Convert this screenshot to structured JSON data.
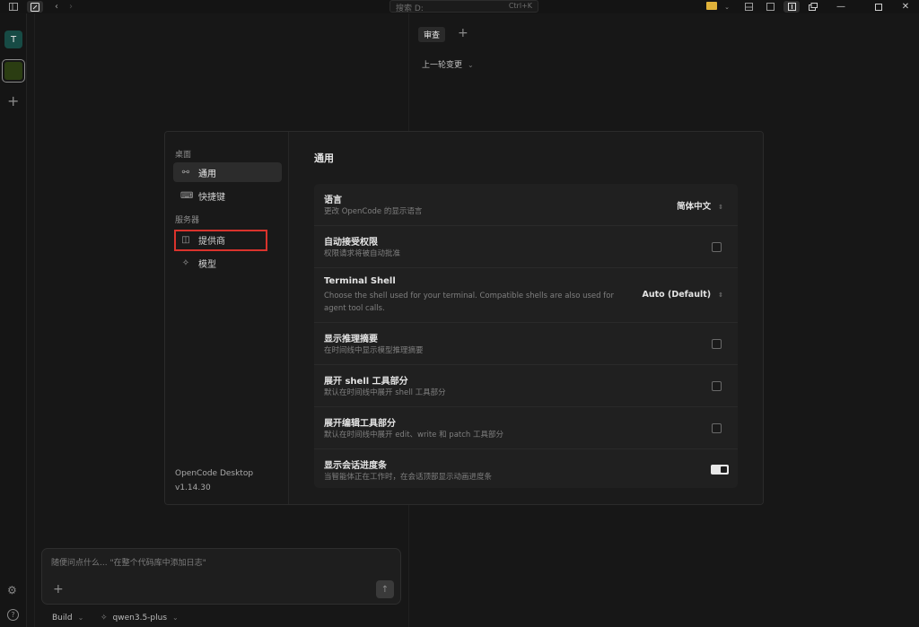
{
  "titlebar": {
    "search_placeholder": "搜索 D:",
    "search_shortcut": "Ctrl+K"
  },
  "rail": {
    "project_initial": "T"
  },
  "review": {
    "tab_label": "审查",
    "last_round_label": "上一轮变更"
  },
  "composer": {
    "placeholder": "随便问点什么... \"在整个代码库中添加日志\"",
    "agent": "Build",
    "model": "qwen3.5-plus"
  },
  "settings": {
    "group_desktop": "桌面",
    "nav_general": "通用",
    "nav_shortcuts": "快捷键",
    "group_server": "服务器",
    "nav_providers": "提供商",
    "nav_models": "模型",
    "app_name": "OpenCode Desktop",
    "app_version": "v1.14.30",
    "title": "通用",
    "rows": [
      {
        "title": "语言",
        "desc": "更改 OpenCode 的显示语言",
        "value": "简体中文",
        "control": "select"
      },
      {
        "title": "自动接受权限",
        "desc": "权限请求将被自动批准",
        "control": "checkbox",
        "checked": false
      },
      {
        "title": "Terminal Shell",
        "desc": "Choose the shell used for your terminal. Compatible shells are also used for agent tool calls.",
        "value": "Auto (Default)",
        "control": "select"
      },
      {
        "title": "显示推理摘要",
        "desc": "在时间线中显示模型推理摘要",
        "control": "checkbox",
        "checked": false
      },
      {
        "title": "展开 shell 工具部分",
        "desc": "默认在时间线中展开 shell 工具部分",
        "control": "checkbox",
        "checked": false
      },
      {
        "title": "展开编辑工具部分",
        "desc": "默认在时间线中展开 edit、write 和 patch 工具部分",
        "control": "checkbox",
        "checked": false
      },
      {
        "title": "显示会话进度条",
        "desc": "当智能体正在工作时，在会话顶部显示动画进度条",
        "control": "toggle",
        "checked": true
      }
    ]
  },
  "colors": {
    "highlight": "#d9332c",
    "folder": "#e0b23a",
    "project_t": "#174b45",
    "project_selected": "#2b3d12"
  }
}
